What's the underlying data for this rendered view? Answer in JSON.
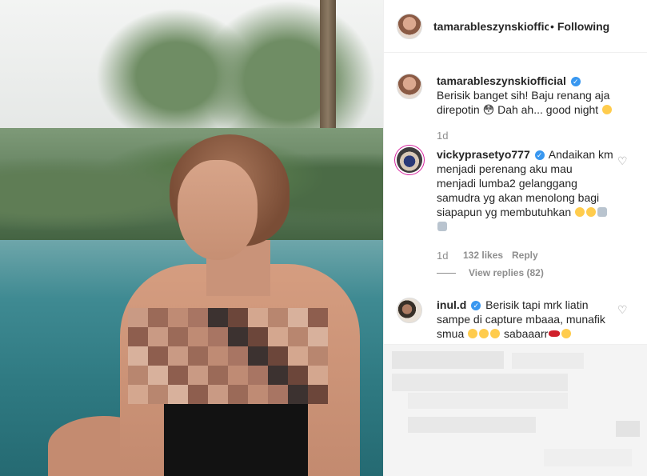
{
  "post": {
    "author": "tamarableszynskiofficial",
    "follow_separator": "•",
    "follow_status": "Following"
  },
  "comments": [
    {
      "username": "tamarableszynskiofficial",
      "verified": true,
      "text": "Berisik banget sih! Baju renang aja direpotin 😳 Dah ah... good night",
      "time": "1d"
    },
    {
      "username": "vickyprasetyo777",
      "verified": true,
      "text": "Andaikan km menjadi perenang aku mau menjadi lumba2 gelanggang samudra yg akan menolong bagi siapapun yg membutuhkan",
      "time": "1d",
      "likes": "132 likes",
      "reply_label": "Reply",
      "view_replies": "View replies (82)"
    },
    {
      "username": "inul.d",
      "verified": true,
      "text": "Berisik tapi mrk liatin sampe di capture mbaaa, munafik smua",
      "text_suffix": "sabaaarr"
    }
  ],
  "icons": {
    "verified": "verified-badge-icon",
    "heart": "heart-icon"
  },
  "colors": {
    "verified_blue": "#3897f0",
    "meta_gray": "#8e8e8e",
    "text": "#262626",
    "story_ring": "#d6249f"
  }
}
